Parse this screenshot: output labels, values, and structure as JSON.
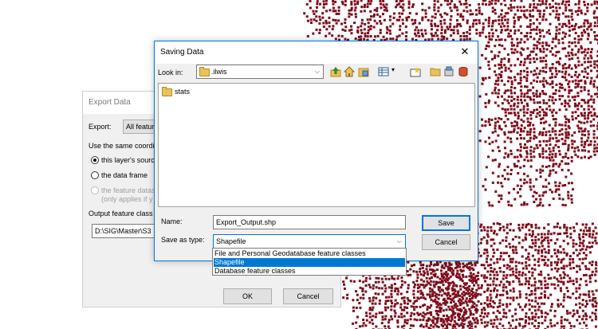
{
  "colors": {
    "accent": "#0078d7",
    "desktop_pattern": "#7d0c1a"
  },
  "export_dialog": {
    "title": "Export Data",
    "export_label": "Export:",
    "export_value": "All featur",
    "coordinate_label": "Use the same coordi",
    "radio_layer_source": "this layer's source",
    "radio_data_frame": "the data frame",
    "radio_feature_dataset": "the feature datas",
    "radio_feature_note": "(only applies if y",
    "output_label": "Output feature class",
    "output_value": "D:\\SIG\\Master\\S3",
    "ok_label": "OK",
    "cancel_label": "Cancel"
  },
  "saving_dialog": {
    "title": "Saving Data",
    "close_glyph": "✕",
    "look_in_label": "Look in:",
    "look_in_value": ".ilwis",
    "toolbar_icons": [
      "up-one-level-icon",
      "home-icon",
      "connect-folder-icon",
      "view-menu-icon",
      "new-folder-icon",
      "folder-icon",
      "catalog-icon",
      "database-icon"
    ],
    "files": [
      {
        "name": "stats",
        "icon": "folder-icon"
      }
    ],
    "name_label": "Name:",
    "name_value": "Export_Output.shp",
    "save_label": "Save",
    "save_as_type_label": "Save as type:",
    "save_as_type_value": "Shapefile",
    "cancel_label": "Cancel",
    "type_options": [
      {
        "label": "File and Personal Geodatabase feature classes",
        "selected": false
      },
      {
        "label": "Shapefile",
        "selected": true
      },
      {
        "label": "Database feature classes",
        "selected": false
      }
    ]
  }
}
